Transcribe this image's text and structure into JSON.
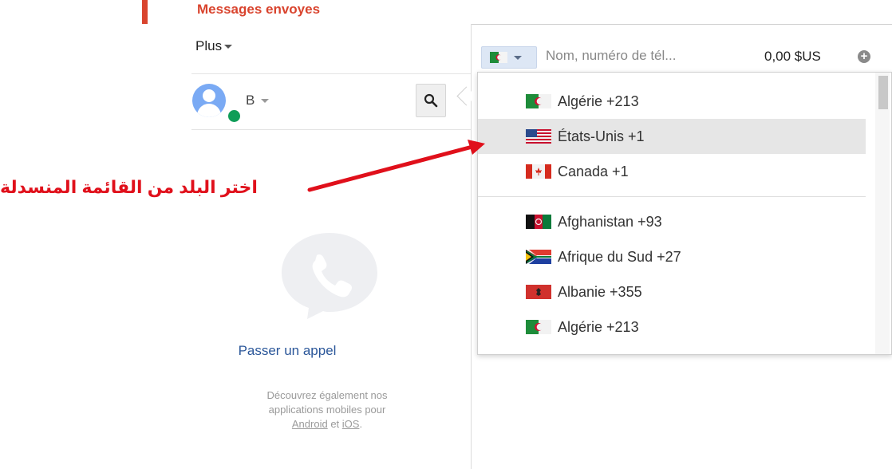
{
  "left_panel": {
    "sent_label": "Messages envoyes",
    "more_menu": "Plus",
    "user_name": "B",
    "call_title": "Passer un appel",
    "apps_note_line1": "Découvrez également nos",
    "apps_note_line2": "applications mobiles pour",
    "apps_note_android": "Android",
    "apps_note_and": "et",
    "apps_note_ios": "iOS",
    "apps_note_end": "."
  },
  "dialer": {
    "phone_placeholder": "Nom, numéro de tél...",
    "credit": "0,00 $US",
    "add_credit_icon": "plus-circle-icon",
    "selected_country_flag": "algeria"
  },
  "country_dropdown": {
    "hovered_index": 1,
    "items": [
      {
        "name": "Algérie +213",
        "flag": "algeria"
      },
      {
        "name": "États-Unis +1",
        "flag": "usa"
      },
      {
        "name": "Canada +1",
        "flag": "canada"
      },
      {
        "name": "Afghanistan +93",
        "flag": "afghanistan"
      },
      {
        "name": "Afrique du Sud +27",
        "flag": "south-africa"
      },
      {
        "name": "Albanie +355",
        "flag": "albania"
      },
      {
        "name": "Algérie +213",
        "flag": "algeria"
      }
    ]
  },
  "annotation": {
    "text": "اختر البلد من القائمة المنسدلة",
    "color": "#e0101b"
  },
  "colors": {
    "accent_red": "#d9442e",
    "link_blue": "#2a5699",
    "presence_green": "#0f9d58",
    "avatar_blue": "#7aaaf4"
  }
}
